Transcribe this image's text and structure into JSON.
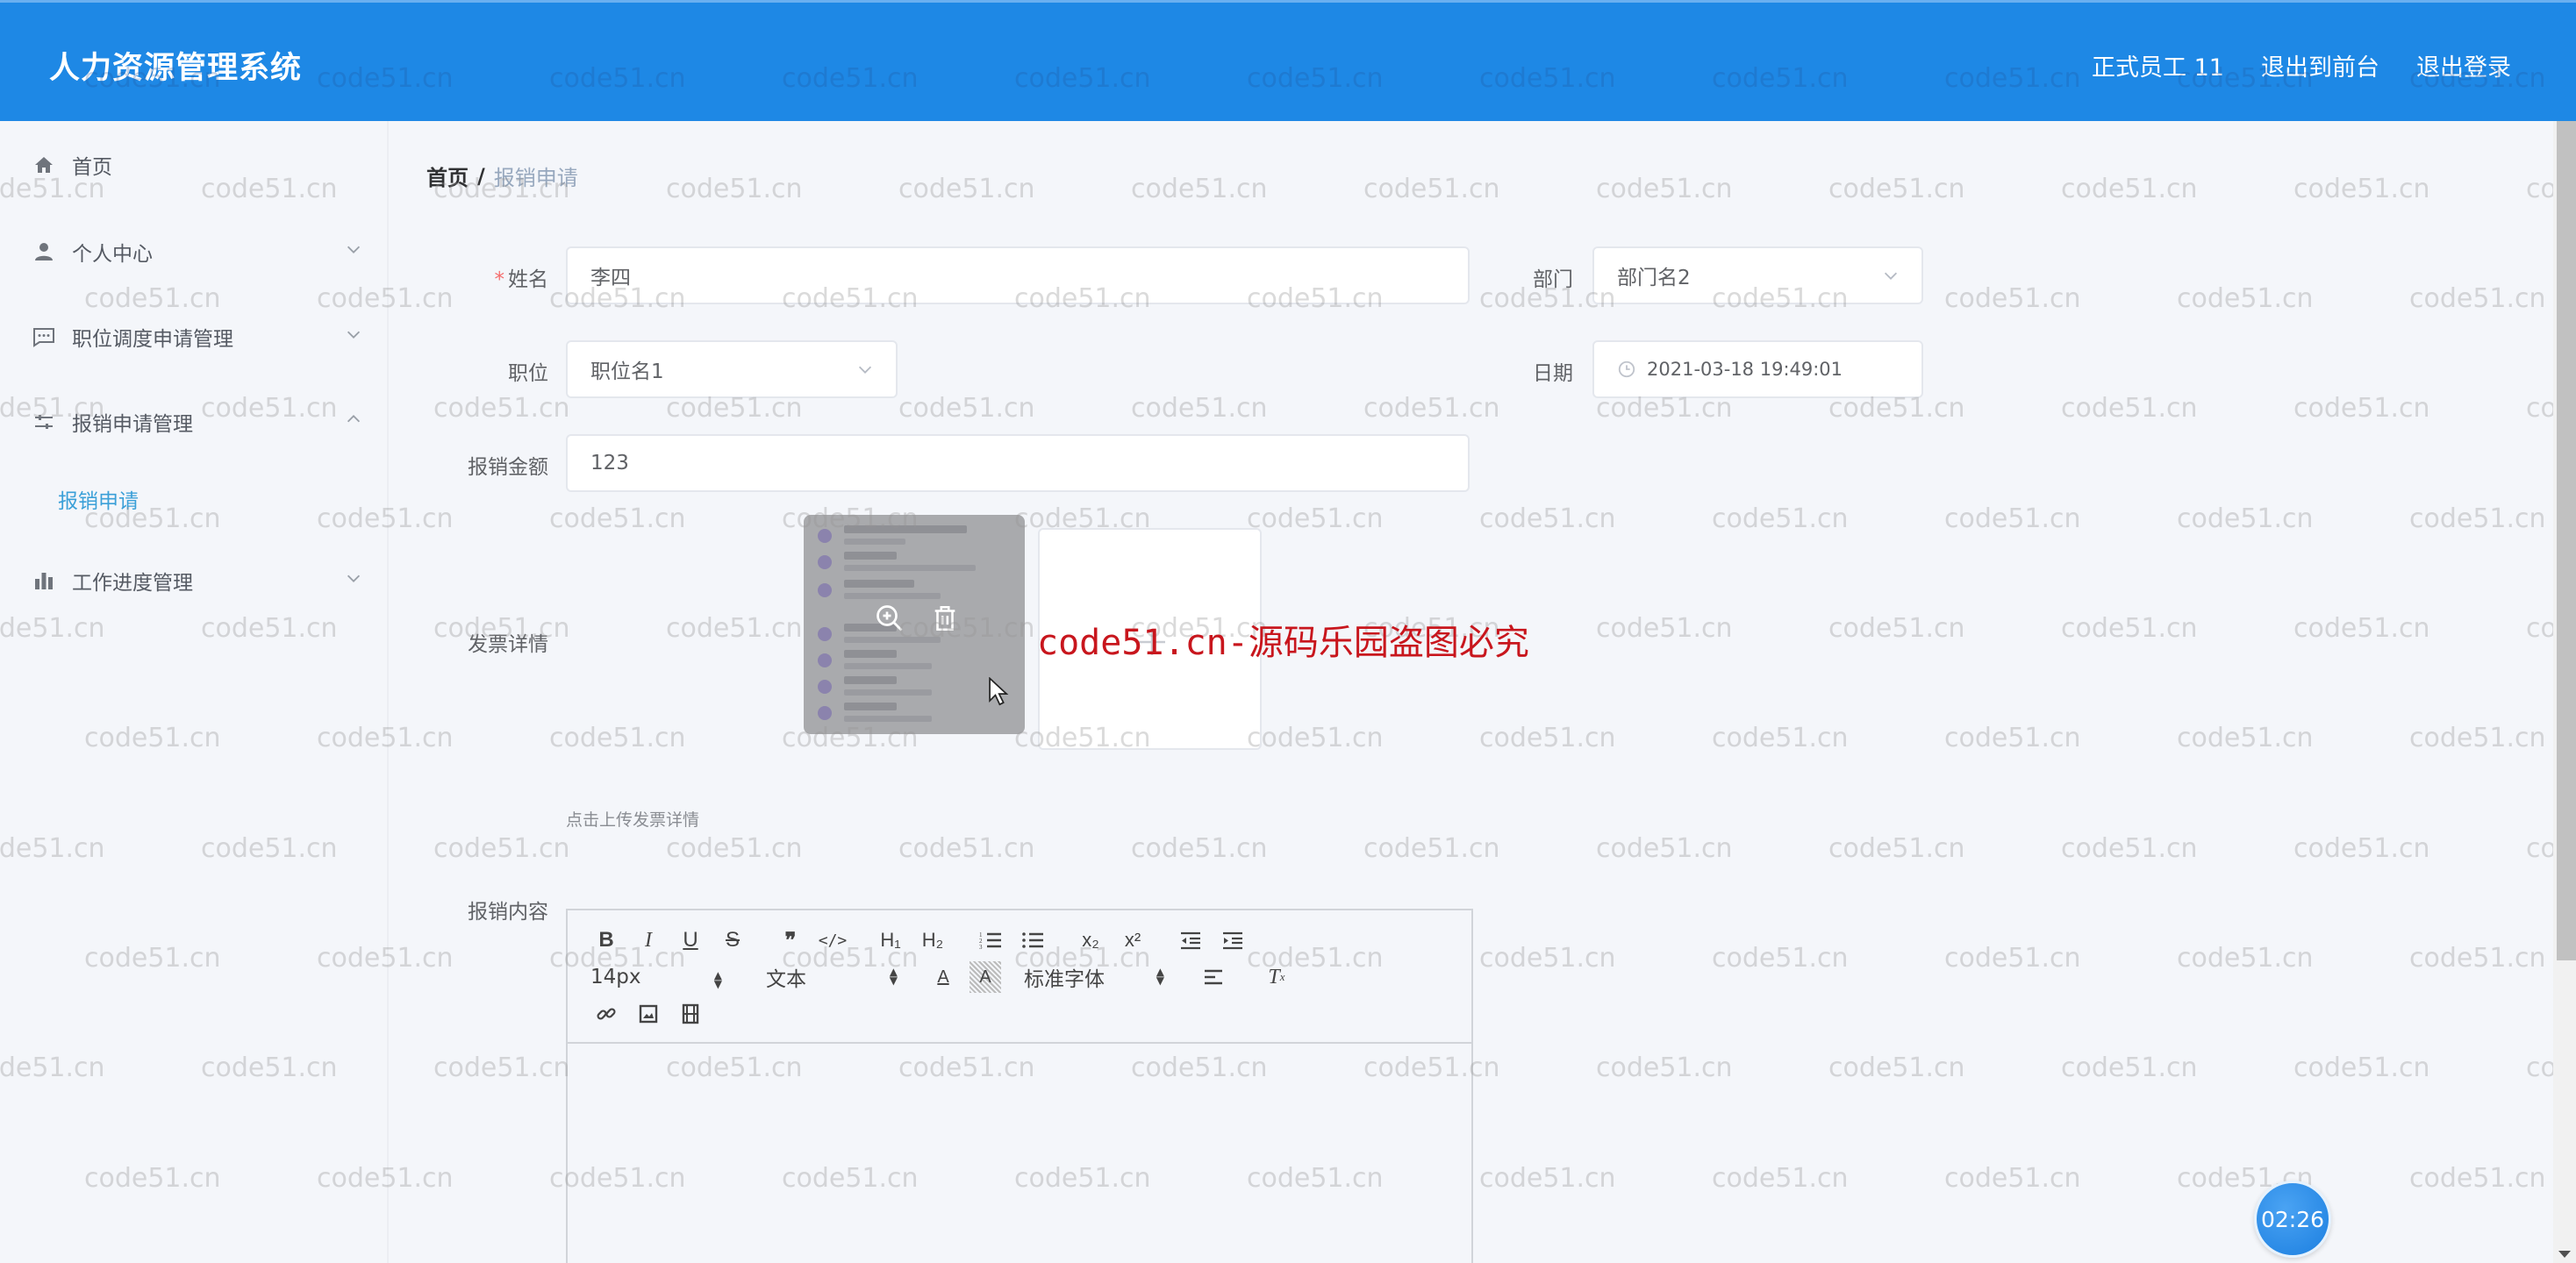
{
  "header": {
    "title": "人力资源管理系统",
    "user_role": "正式员工 11",
    "to_frontend": "退出到前台",
    "logout": "退出登录",
    "bg_color": "#1e88e5"
  },
  "sidebar": {
    "items": [
      {
        "label": "首页",
        "icon": "home-icon"
      },
      {
        "label": "个人中心",
        "icon": "user-icon",
        "expandable": true
      },
      {
        "label": "职位调度申请管理",
        "icon": "chat-icon",
        "expandable": true
      },
      {
        "label": "报销申请管理",
        "icon": "sliders-icon",
        "expandable": true,
        "expanded": true
      },
      {
        "label": "工作进度管理",
        "icon": "bar-chart-icon",
        "expandable": true
      }
    ],
    "subitems": [
      {
        "label": "报销申请",
        "active": true
      }
    ],
    "active_color": "#3ba0d8"
  },
  "breadcrumb": {
    "home": "首页",
    "separator": "/",
    "current": "报销申请"
  },
  "form": {
    "name": {
      "label": "姓名",
      "required": true,
      "value": "李四"
    },
    "department": {
      "label": "部门",
      "value": "部门名2"
    },
    "position": {
      "label": "职位",
      "value": "职位名1"
    },
    "date": {
      "label": "日期",
      "value": "2021-03-18 19:49:01"
    },
    "amount": {
      "label": "报销金额",
      "value": "123"
    },
    "invoice": {
      "label": "发票详情",
      "tip": "点击上传发票详情"
    },
    "content": {
      "label": "报销内容",
      "value": ""
    }
  },
  "editor": {
    "toolbar_row1": [
      "B",
      "I",
      "U",
      "S",
      "quote",
      "code",
      "H1",
      "H2",
      "ordered-list",
      "bullet-list",
      "subscript",
      "superscript",
      "outdent",
      "indent"
    ],
    "font_size": "14px",
    "block_type": "文本",
    "font_family": "标准字体",
    "toolbar_row3": [
      "link",
      "image",
      "video"
    ]
  },
  "overlay": {
    "red_watermark": "code51.cn-源码乐园盗图必究",
    "watermark": "code51.cn",
    "timer": "02:26"
  }
}
